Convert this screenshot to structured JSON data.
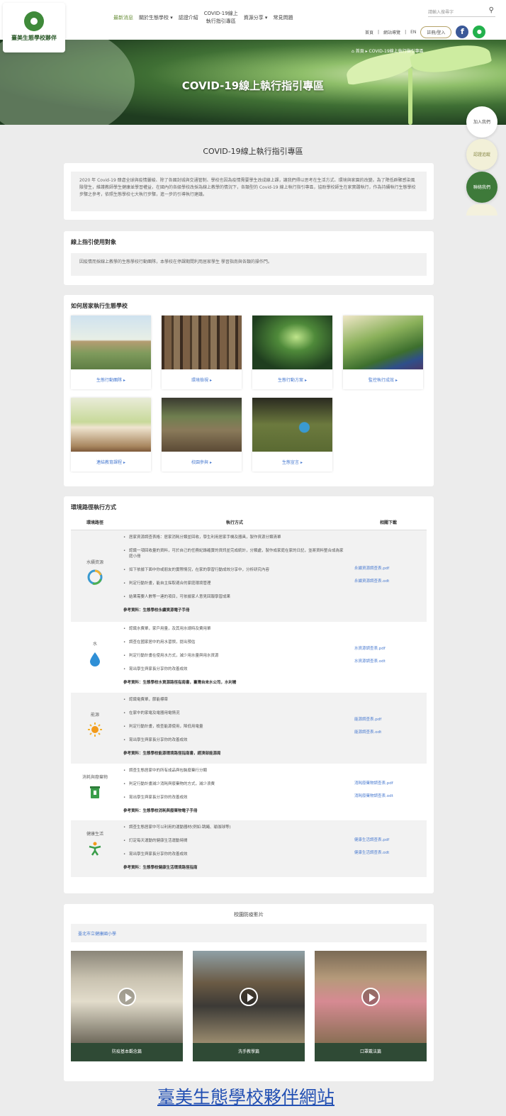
{
  "header": {
    "logo_text": "臺美生態學校夥伴",
    "nav": [
      "最新消息",
      "關於生態學校 ▾",
      "認證介紹",
      "COVID-19線上",
      "執行指引專區",
      "資源分享 ▾",
      "常見問題"
    ],
    "search_placeholder": "請輸入搜尋字",
    "util_links": [
      "首頁",
      "網站導覽",
      "EN"
    ],
    "login_label": "註冊/登入"
  },
  "banner": {
    "title": "COVID-19線上執行指引專區",
    "breadcrumb": "⌂ 首頁 ▸ COVID-19線上執行指引專區"
  },
  "side_buttons": [
    "加入我們",
    "認證追蹤",
    "聯絡我們"
  ],
  "page_title": "COVID-19線上執行指引專區",
  "intro": "2020 年 Covid-19 肆虐全球與疫情嚴峻、除了各國封城與交通管制、學校也因為疫情需要學生改成線上課，讓我們得以思考在生活方式、環境與家園的改變。為了降低群聚感染風險發生，維護教師學生健康並學習權益，在國內的各級學校改採為線上教學的情況下，各類型的 Covid-19 線上執行指引專區，協助學校師生在家實踐執行，作為持續執行生態學校步驟之參考，依照生態學校七大執行步驟，進一步的引導執行建議。",
  "usage": {
    "title": "線上指引使用對象",
    "text": "因疫情而採線上教學的生態學校行動團隊，本學校在停課期間利用居家學生 學習指南與各類的操作門。"
  },
  "howto": {
    "title": "如何居家執行生態學校",
    "tiles": [
      "生態行動團隊 ▸",
      "環境檢視 ▸",
      "生態行動方案 ▸",
      "監控執行成效 ▸",
      "連結教育課程 ▸",
      "校園參與 ▸",
      "生態宣言 ▸"
    ]
  },
  "table": {
    "title": "環境路徑執行方式",
    "headers": [
      "環境路徑",
      "執行方式",
      "相關下載"
    ],
    "rows": [
      {
        "category": "水續資源",
        "icon": "recycle-circle-icon",
        "bullets": [
          "居家資源調查表格：居家消耗分類並回收，學生利用居家手機及器具，製作資源分類清單",
          "認識一項回收量的資料，可於自己的任務紀錄確實的資訊並完成統計，分類處，製作成家庭在家的日記，並將資料整合成為家庭小冊",
          "如下依據下面中你或朋友的實際情況，在家的學習行動成效分享中，分析研究內容",
          "判定行動計畫，能自主採取適合的家庭環境管理",
          "結果需要人數等一連的項目，可依據家人意見回報學習成果"
        ],
        "ref": "參考資料：生態學校永續資源電子手冊",
        "downloads": [
          "永續資源調查表.pdf",
          "永續資源調查表.odt"
        ]
      },
      {
        "category": "水",
        "icon": "water-drop-icon",
        "bullets": [
          "認識水費單，家戶用量，及其用水總時及費用單",
          "調查在國家居中的用水習慣，提出預估",
          "判定行動計畫在使用水方式，減少用水量與用水資源",
          "寫出學生與家長分享你的改善成效"
        ],
        "ref": "參考資料：生態學校水資源路徑指南書，臺灣自來水公司，水利署",
        "downloads": [
          "水資源調查表.pdf",
          "水資源調查表.odt"
        ]
      },
      {
        "category": "能源",
        "icon": "sun-icon",
        "bullets": [
          "認識電費單，節能標章",
          "在家中的家電及電器用電情況",
          "判定行動計畫，檢查能源使用，降低用電量",
          "寫出學生與家長分享你的改善成效"
        ],
        "ref": "參考資料：生態學校能源環境路徑指南書，經濟部能源局",
        "downloads": [
          "能源調查表.pdf",
          "能源調查表.odt"
        ]
      },
      {
        "category": "消耗與廢棄物",
        "icon": "trash-bin-icon",
        "bullets": [
          "調查生態居家中的所有成品與包裝廢棄行分類",
          "判定行動計畫減少消耗與廢棄物的方式，減少浪費",
          "寫出學生與家長分享你的改善成效"
        ],
        "ref": "參考資料：生態學校消耗與廢棄物電子手冊",
        "downloads": [
          "消耗廢棄物調查表.pdf",
          "消耗廢棄物調查表.odt"
        ]
      },
      {
        "category": "健康生活",
        "icon": "fitness-person-icon",
        "bullets": [
          "調查生態居家中可以利用的運動器材(例如:跳繩、瑜珈球等)",
          "訂定每天運動的健康生活運動時間",
          "寫出學生與家長分享你的改善成效"
        ],
        "ref": "參考資料：生態學校健康生活環境路徑指南",
        "downloads": [
          "健康生活調查表.pdf",
          "健康生活調查表.odt"
        ]
      }
    ]
  },
  "videos": {
    "title": "校園防疫影片",
    "school": "臺北市立健康國小學",
    "items": [
      "防疫基本觀念篇",
      "洗手教學篇",
      "口罩戴法篇"
    ]
  },
  "footer_title": "臺美生態學校夥伴網站",
  "colors": {
    "accent_green": "#3e7a3a",
    "link_blue": "#4a7bd0",
    "video_caption": "#2f4a35"
  }
}
